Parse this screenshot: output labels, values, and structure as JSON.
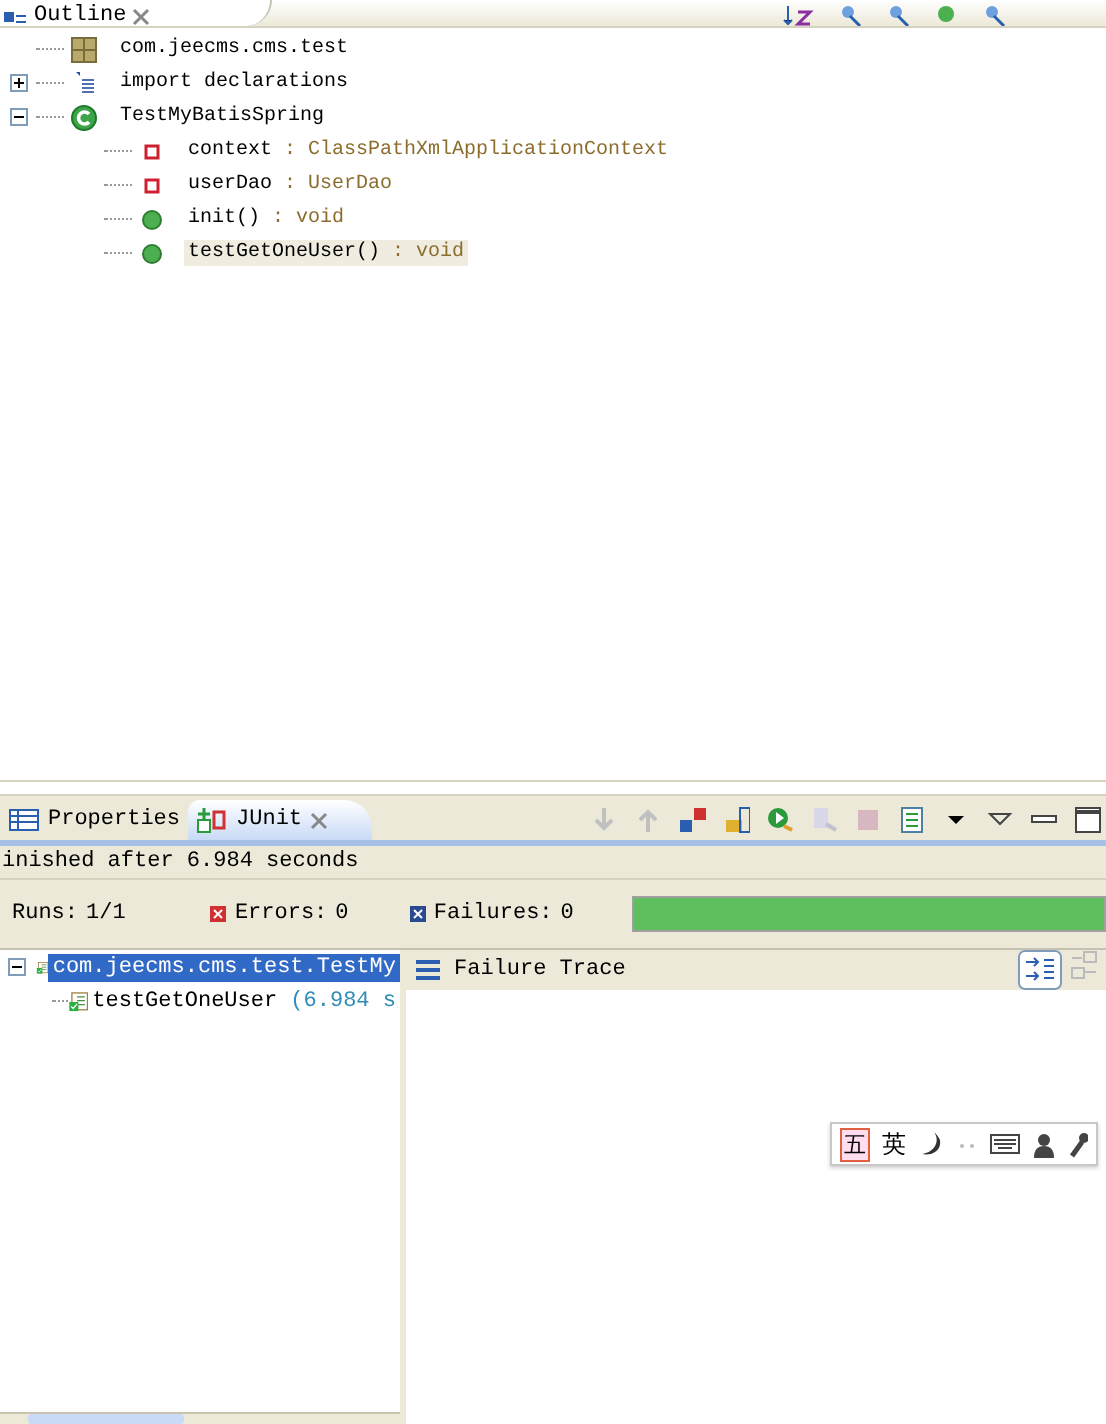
{
  "outline": {
    "tab": {
      "title": "Outline"
    },
    "tree": [
      {
        "kind": "package",
        "label": "com.jeecms.cms.test",
        "selected": false
      },
      {
        "kind": "imports",
        "label": "import declarations",
        "expanded": false,
        "selected": false
      },
      {
        "kind": "class",
        "label": "TestMyBatisSpring",
        "expanded": true,
        "selected": false,
        "children": [
          {
            "kind": "field",
            "label": "context",
            "type": ": ClassPathXmlApplicationContext",
            "selected": false
          },
          {
            "kind": "field",
            "label": "userDao",
            "type": ": UserDao",
            "selected": false
          },
          {
            "kind": "method",
            "label": "init()",
            "type": ": void",
            "selected": false
          },
          {
            "kind": "method",
            "label": "testGetOneUser()",
            "type": ": void",
            "selected": true
          }
        ]
      }
    ]
  },
  "junit": {
    "tabs": [
      {
        "label": "Properties",
        "selected": false
      },
      {
        "label": "JUnit",
        "selected": true
      }
    ],
    "status": "inished after 6.984 seconds",
    "counters": [
      {
        "kind": "runs",
        "label": "Runs:",
        "value": "1/1"
      },
      {
        "kind": "errors",
        "label": "Errors:",
        "value": "0"
      },
      {
        "kind": "failures",
        "label": "Failures:",
        "value": "0"
      }
    ],
    "progress": {
      "level": 1
    },
    "results": [
      {
        "label": "com.jeecms.cms.test.TestMy",
        "selected": true,
        "expanded": true,
        "children": [
          {
            "label": "testGetOneUser",
            "time": "(6.984 s",
            "selected": false
          }
        ]
      }
    ],
    "trace": {
      "title": "Failure Trace"
    }
  },
  "ime_toolbar": {
    "items": [
      "五",
      "英"
    ]
  }
}
